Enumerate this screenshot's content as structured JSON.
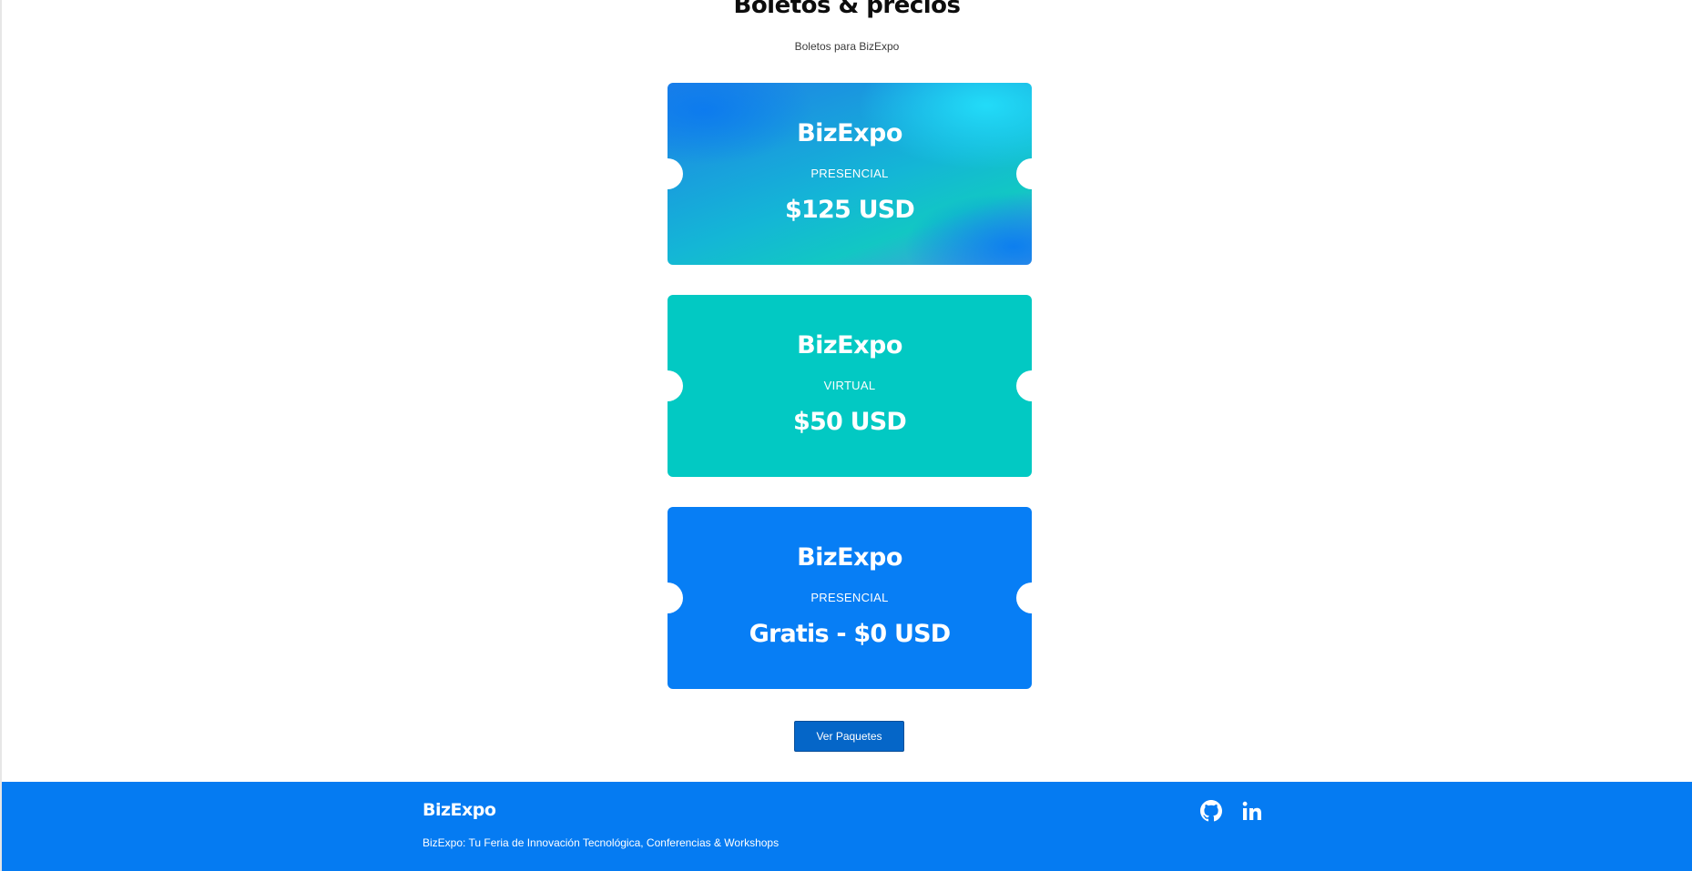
{
  "section": {
    "title": "Boletos & precios",
    "subtitle": "Boletos para BizExpo"
  },
  "tickets": [
    {
      "brand": "BizExpo",
      "type": "PRESENCIAL",
      "price": "$125 USD"
    },
    {
      "brand": "BizExpo",
      "type": "VIRTUAL",
      "price": "$50 USD"
    },
    {
      "brand": "BizExpo",
      "type": "PRESENCIAL",
      "price": "Gratis - $0 USD"
    }
  ],
  "cta": {
    "label": "Ver Paquetes"
  },
  "footer": {
    "brand": "BizExpo",
    "tagline": "BizExpo: Tu Feria de Innovación Tecnológica, Conferencias & Workshops",
    "social": [
      {
        "icon": "github-icon"
      },
      {
        "icon": "linkedin-icon"
      }
    ]
  },
  "colors": {
    "primary_blue": "#057bf2",
    "teal": "#02c9c3",
    "cyan": "#23def a",
    "button_blue": "#0566c8"
  }
}
